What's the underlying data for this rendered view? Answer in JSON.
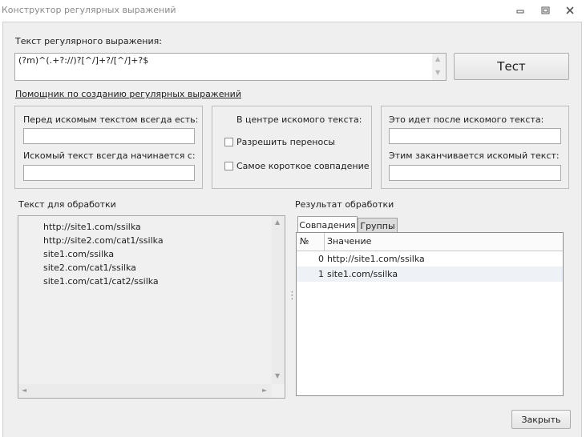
{
  "window": {
    "title": "Конструктор регулярных выражений",
    "minimize_glyph": "▭",
    "restore_glyph": "⧉",
    "close_glyph": "✕"
  },
  "regex": {
    "label": "Текст регулярного выражения:",
    "value": "(?m)^(.+?://)?[^/]+?/[^/]+?$"
  },
  "buttons": {
    "test": "Тест",
    "close": "Закрыть"
  },
  "helper": {
    "link": "Помощник по созданию регулярных выражений",
    "before_label": "Перед искомым текстом всегда есть:",
    "before_value": "",
    "starts_label": "Искомый текст всегда начинается с:",
    "starts_value": "",
    "center_label": "В центре искомого текста:",
    "allow_wrap_label": "Разрешить переносы",
    "shortest_label": "Самое короткое совпадение",
    "after_label": "Это идет после искомого текста:",
    "after_value": "",
    "ends_label": "Этим заканчивается искомый текст:",
    "ends_value": ""
  },
  "source": {
    "label": "Текст для обработки",
    "lines": [
      "http://site1.com/ssilka",
      "http://site2.com/cat1/ssilka",
      "site1.com/ssilka",
      "site2.com/cat1/ssilka",
      "site1.com/cat1/cat2/ssilka"
    ]
  },
  "result": {
    "label": "Результат обработки",
    "tabs": [
      "Совпадения",
      "Группы"
    ],
    "columns": [
      "№",
      "Значение"
    ],
    "rows": [
      {
        "num": "0",
        "value": "http://site1.com/ssilka"
      },
      {
        "num": "1",
        "value": "site1.com/ssilka"
      }
    ]
  },
  "icons": {
    "scroll_up": "▲",
    "scroll_down": "▼",
    "scroll_left": "◄",
    "scroll_right": "►",
    "splitter": "⋮"
  }
}
